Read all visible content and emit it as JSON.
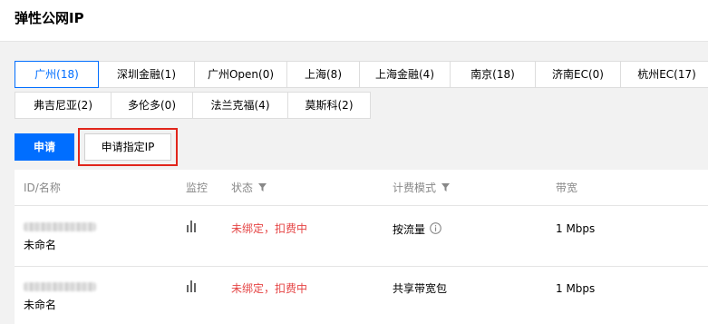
{
  "header": {
    "title": "弹性公网IP"
  },
  "region_tabs_row1": [
    {
      "label": "广州(18)",
      "active": true
    },
    {
      "label": "深圳金融(1)",
      "active": false
    },
    {
      "label": "广州Open(0)",
      "active": false
    },
    {
      "label": "上海(8)",
      "active": false
    },
    {
      "label": "上海金融(4)",
      "active": false
    },
    {
      "label": "南京(18)",
      "active": false
    },
    {
      "label": "济南EC(0)",
      "active": false
    },
    {
      "label": "杭州EC(17)",
      "active": false
    }
  ],
  "region_tabs_row2": [
    {
      "label": "弗吉尼亚(2)",
      "active": false
    },
    {
      "label": "多伦多(0)",
      "active": false
    },
    {
      "label": "法兰克福(4)",
      "active": false
    },
    {
      "label": "莫斯科(2)",
      "active": false
    }
  ],
  "actions": {
    "apply_label": "申请",
    "apply_specific_label": "申请指定IP"
  },
  "table": {
    "columns": {
      "id_name": "ID/名称",
      "monitor": "监控",
      "status": "状态",
      "billing": "计费模式",
      "bandwidth": "带宽"
    },
    "rows": [
      {
        "name": "未命名",
        "status": "未绑定，扣费中",
        "billing": "按流量",
        "bandwidth": "1 Mbps"
      },
      {
        "name": "未命名",
        "status": "未绑定，扣费中",
        "billing": "共享带宽包",
        "bandwidth": "1 Mbps"
      }
    ]
  },
  "colors": {
    "accent": "#006eff",
    "status_warning": "#e54545",
    "highlight_box": "#e1251b"
  }
}
